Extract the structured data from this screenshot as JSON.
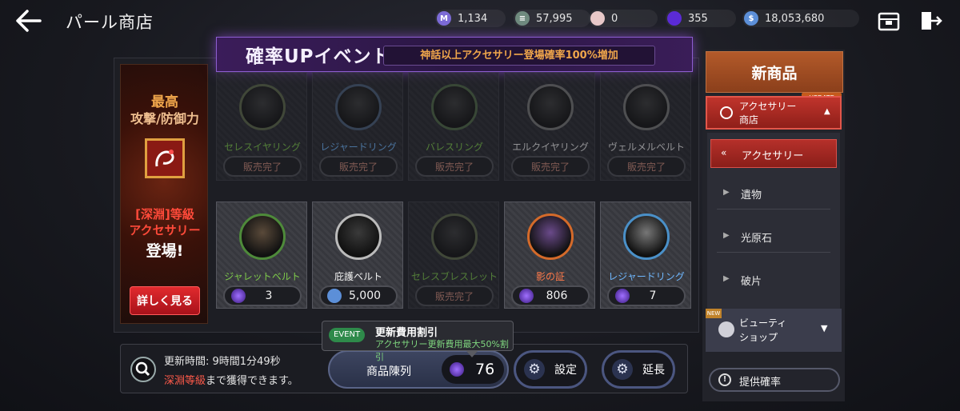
{
  "header": {
    "title": "パール商店",
    "currencies": [
      {
        "icon": "moonstone-icon",
        "value": "1,134",
        "color": "#7c6bd6"
      },
      {
        "icon": "silver-coin-stack-icon",
        "value": "57,995",
        "color": "#6f8a7e"
      },
      {
        "icon": "pearl-icon",
        "value": "0",
        "color": "#e8c8c8"
      },
      {
        "icon": "purple-gem-icon",
        "value": "355",
        "color": "#5b2bd6"
      },
      {
        "icon": "silver-coin-icon",
        "value": "18,053,680",
        "color": "#5c8fd8"
      }
    ]
  },
  "promo": {
    "line1": "最高",
    "line2": "攻撃/防御力",
    "line3": "[深淵]等級",
    "line4": "アクセサリー",
    "line5": "登場!",
    "details_button": "詳しく見る"
  },
  "event_banner": {
    "title": "確率UPイベント",
    "subtitle": "神話以上アクセサリー登場確率100%増加"
  },
  "items_row1": [
    {
      "name": "セレスイヤリング",
      "status": "販売完了",
      "ring": "#5d6a4a"
    },
    {
      "name": "レジャードリング",
      "status": "販売完了",
      "ring": "#4a5f7a"
    },
    {
      "name": "バレスリング",
      "status": "販売完了",
      "ring": "#4f6a45"
    },
    {
      "name": "エルクイヤリング",
      "status": "販売完了",
      "ring": "#666"
    },
    {
      "name": "ヴェルメルベルト",
      "status": "販売完了",
      "ring": "#666"
    }
  ],
  "items_row2": [
    {
      "name": "ジャレットベルト",
      "price": "3",
      "currency": "purple-gem-icon",
      "ring": "#4e8a3a",
      "name_color": "#7ecb4a"
    },
    {
      "name": "庇護ベルト",
      "price": "5,000",
      "currency": "silver-coin-icon",
      "ring": "#bbbbbb",
      "name_color": "#f0f0f0"
    },
    {
      "name": "セレスブレスレット",
      "status": "販売完了",
      "ring": "#5d6a4a",
      "name_color": "#7ecb4a"
    },
    {
      "name": "影の証",
      "price": "806",
      "currency": "purple-gem-icon",
      "ring": "#d46a2a",
      "name_color": "#ff7a4a"
    },
    {
      "name": "レジャードリング",
      "price": "7",
      "currency": "purple-gem-icon",
      "ring": "#4a90c8",
      "name_color": "#6fb8ff"
    }
  ],
  "tooltip": {
    "badge": "EVENT",
    "title": "更新費用割引",
    "subtitle": "アクセサリー更新費用最大50%割引"
  },
  "bottom": {
    "refresh_time": "更新時間: 9時間1分49秒",
    "hint_red": "深淵等級",
    "hint_rest": "まで獲得できます。",
    "lineup_label": "商品陳列",
    "lineup_cost": "76",
    "settings_label": "設定",
    "extend_label": "延長"
  },
  "sidebar": {
    "new_items": "新商品",
    "accessory_shop_line1": "アクセサリー",
    "accessory_shop_line2": "商店",
    "update_tag": "UPDATE",
    "sub_active": "アクセサリー",
    "sub_items": [
      "遺物",
      "光原石",
      "破片"
    ],
    "beauty_line1": "ビューティ",
    "beauty_line2": "ショップ",
    "new_tag": "NEW",
    "probability_button": "提供確率"
  }
}
